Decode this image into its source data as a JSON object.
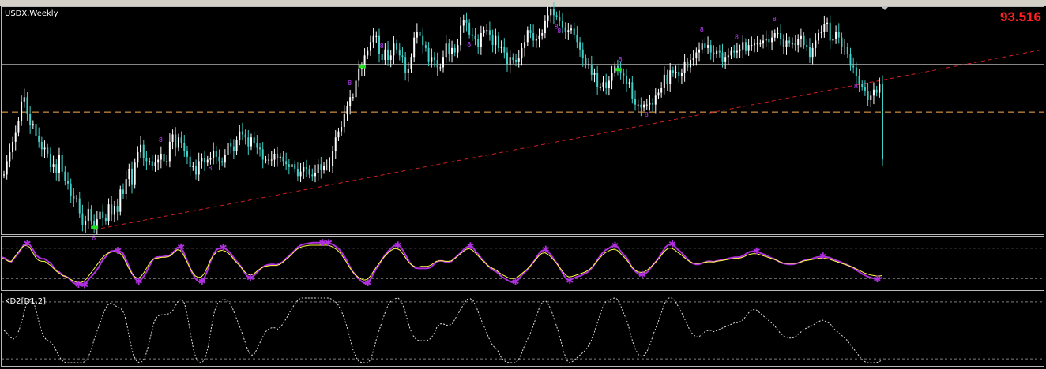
{
  "window": {
    "symbol_label": "USDX,Weekly",
    "current_price": "93.516",
    "price_color": "#ff2020"
  },
  "indicator2": {
    "label": "KD2[D1,2]"
  },
  "colors": {
    "candle_up": "#ffffff",
    "candle_down": "#40d0c8",
    "trendline": "#d02020",
    "support_line": "#ffb050",
    "stoch_main": "#b030e0",
    "stoch_signal": "#ffff40",
    "kd_line": "#e0e0e0",
    "marker": "#c040ff",
    "signal_box": "#20e020"
  },
  "chart_data": [
    {
      "type": "candlestick",
      "pane": "price",
      "title": "USDX,Weekly",
      "last_price": 93.516,
      "ylim": [
        88.5,
        103.8
      ],
      "closes": [
        92.5,
        93.4,
        94.0,
        94.7,
        95.3,
        96.1,
        97.4,
        97.7,
        96.6,
        95.8,
        95.9,
        95.1,
        94.7,
        94.2,
        94.3,
        93.9,
        93.0,
        93.2,
        92.6,
        93.8,
        92.7,
        92.1,
        91.9,
        91.1,
        90.9,
        90.9,
        89.9,
        89.1,
        89.4,
        90.2,
        89.4,
        88.9,
        89.5,
        90.0,
        89.6,
        89.4,
        90.5,
        89.8,
        90.4,
        90.0,
        91.5,
        91.2,
        92.2,
        92.9,
        91.8,
        93.3,
        94.0,
        94.5,
        93.6,
        93.4,
        93.4,
        93.1,
        93.3,
        93.5,
        93.9,
        93.4,
        93.4,
        94.7,
        95.2,
        94.3,
        95.0,
        94.6,
        94.1,
        93.7,
        93.0,
        93.1,
        92.5,
        93.4,
        93.6,
        93.3,
        93.5,
        93.6,
        94.1,
        93.7,
        93.4,
        93.3,
        93.8,
        94.6,
        94.4,
        94.1,
        94.8,
        95.4,
        95.2,
        95.0,
        94.4,
        95.0,
        94.6,
        94.3,
        94.2,
        93.5,
        93.5,
        93.5,
        93.5,
        93.9,
        93.6,
        93.7,
        93.4,
        93.2,
        93.0,
        93.2,
        92.9,
        92.4,
        92.7,
        93.0,
        92.9,
        92.5,
        92.4,
        92.6,
        93.2,
        92.8,
        93.1,
        93.1,
        93.1,
        94.1,
        95.0,
        95.4,
        95.7,
        96.6,
        97.1,
        97.7,
        97.7,
        98.8,
        99.6,
        99.7,
        100.5,
        100.8,
        101.4,
        101.8,
        101.8,
        100.6,
        100.2,
        100.9,
        100.2,
        100.5,
        101.3,
        100.9,
        100.5,
        100.4,
        99.3,
        99.6,
        100.4,
        101.7,
        102.1,
        101.8,
        101.2,
        101.0,
        100.1,
        100.4,
        100.2,
        99.7,
        99.7,
        100.4,
        101.3,
        100.6,
        101.0,
        100.7,
        101.2,
        102.5,
        102.9,
        102.7,
        101.9,
        101.8,
        101.6,
        101.1,
        102.0,
        102.2,
        102.2,
        101.9,
        101.2,
        101.8,
        101.0,
        101.1,
        100.7,
        99.9,
        100.4,
        100.2,
        100.1,
        100.3,
        101.0,
        101.4,
        102.2,
        102.0,
        101.5,
        101.6,
        101.8,
        102.0,
        102.8,
        103.2,
        103.6,
        103.2,
        103.1,
        102.8,
        102.4,
        102.1,
        102.2,
        102.3,
        101.9,
        101.4,
        100.9,
        100.3,
        99.9,
        99.9,
        99.2,
        99.3,
        98.4,
        98.4,
        98.7,
        98.3,
        98.8,
        99.3,
        99.8,
        99.5,
        99.3,
        99.1,
        98.6,
        98.7,
        97.6,
        97.2,
        97.2,
        97.0,
        97.2,
        97.2,
        97.3,
        97.2,
        97.8,
        98.0,
        98.3,
        99.2,
        98.6,
        99.5,
        99.3,
        99.4,
        99.1,
        99.3,
        100.1,
        99.7,
        100.2,
        100.3,
        100.7,
        100.9,
        101.3,
        101.0,
        101.2,
        100.7,
        100.6,
        100.8,
        100.7,
        100.1,
        100.4,
        100.5,
        100.8,
        100.7,
        100.8,
        100.9,
        101.4,
        100.8,
        101.2,
        101.2,
        101.3,
        101.3,
        101.3,
        101.5,
        101.6,
        101.4,
        101.7,
        102.0,
        102.0,
        101.6,
        101.1,
        101.5,
        101.3,
        101.3,
        101.2,
        101.6,
        101.8,
        101.2,
        101.1,
        100.4,
        101.0,
        101.5,
        102.0,
        102.1,
        102.6,
        102.7,
        101.5,
        101.6,
        102.1,
        101.7,
        101.1,
        101.1,
        100.6,
        99.8,
        99.7,
        99.1,
        98.6,
        98.4,
        98.1,
        97.5,
        97.8,
        98.2,
        98.0,
        98.6,
        93.516
      ]
    },
    {
      "type": "line",
      "pane": "stochastic",
      "ylim": [
        0,
        100
      ],
      "levels": [
        20,
        80
      ],
      "series": [
        {
          "values": [
            62,
            60,
            55,
            53,
            61,
            68,
            76,
            86,
            89,
            87,
            79,
            68,
            62,
            59,
            59,
            54,
            51,
            42,
            35,
            32,
            26,
            24,
            21,
            14,
            10,
            8,
            9,
            7,
            13,
            21,
            27,
            34,
            43,
            54,
            61,
            69,
            74,
            75,
            75,
            74,
            70,
            58,
            44,
            30,
            20,
            14,
            17,
            25,
            35,
            47,
            58,
            62,
            63,
            63,
            64,
            64,
            68,
            74,
            81,
            82,
            74,
            60,
            45,
            31,
            20,
            14,
            14,
            21,
            35,
            53,
            67,
            77,
            80,
            81,
            79,
            74,
            68,
            59,
            52,
            45,
            35,
            26,
            21,
            23,
            29,
            35,
            41,
            45,
            47,
            48,
            48,
            47,
            50,
            53,
            59,
            64,
            70,
            76,
            82,
            86,
            88,
            89,
            90,
            91,
            91,
            91,
            91,
            90,
            91,
            89,
            86,
            82,
            76,
            68,
            59,
            47,
            36,
            28,
            21,
            15,
            11,
            11,
            17,
            28,
            39,
            48,
            58,
            67,
            74,
            80,
            85,
            86,
            84,
            75,
            64,
            53,
            46,
            41,
            40,
            40,
            40,
            40,
            42,
            47,
            53,
            55,
            55,
            53,
            53,
            54,
            60,
            65,
            71,
            77,
            82,
            84,
            82,
            74,
            67,
            59,
            53,
            46,
            40,
            36,
            33,
            27,
            22,
            19,
            15,
            13,
            13,
            17,
            24,
            31,
            36,
            43,
            51,
            60,
            69,
            75,
            77,
            73,
            67,
            58,
            50,
            40,
            29,
            20,
            16,
            19,
            22,
            24,
            26,
            29,
            32,
            37,
            44,
            53,
            62,
            70,
            76,
            79,
            83,
            85,
            83,
            75,
            68,
            62,
            52,
            41,
            34,
            29,
            27,
            28,
            33,
            40,
            48,
            55,
            63,
            73,
            82,
            87,
            88,
            84,
            78,
            73,
            67,
            60,
            54,
            50,
            48,
            48,
            50,
            52,
            54,
            54,
            53,
            55,
            56,
            57,
            58,
            60,
            61,
            62,
            62,
            63,
            66,
            70,
            73,
            74,
            74,
            72,
            69,
            67,
            64,
            61,
            59,
            56,
            52,
            50,
            49,
            48,
            48,
            49,
            51,
            53,
            56,
            57,
            58,
            60,
            62,
            63,
            64,
            63,
            62,
            60,
            57,
            55,
            53,
            50,
            48,
            45,
            42,
            38,
            34,
            30,
            27,
            24,
            22,
            20,
            19,
            20,
            22
          ]
        },
        {
          "values": [
            60,
            58,
            54,
            54,
            62,
            70,
            78,
            84,
            86,
            82,
            72,
            62,
            56,
            54,
            54,
            50,
            46,
            40,
            34,
            30,
            26,
            24,
            21,
            17,
            14,
            12,
            12,
            14,
            20,
            28,
            36,
            44,
            52,
            60,
            66,
            70,
            72,
            73,
            72,
            70,
            64,
            52,
            40,
            30,
            23,
            20,
            24,
            32,
            42,
            52,
            58,
            60,
            61,
            62,
            62,
            63,
            66,
            72,
            77,
            76,
            68,
            56,
            44,
            33,
            25,
            22,
            23,
            30,
            42,
            56,
            66,
            72,
            75,
            76,
            74,
            70,
            64,
            56,
            50,
            44,
            36,
            30,
            27,
            28,
            32,
            37,
            41,
            44,
            45,
            46,
            46,
            46,
            48,
            52,
            57,
            62,
            68,
            74,
            79,
            82,
            84,
            85,
            86,
            86,
            86,
            86,
            86,
            86,
            86,
            84,
            81,
            77,
            71,
            63,
            54,
            44,
            35,
            28,
            23,
            19,
            17,
            18,
            24,
            33,
            42,
            50,
            58,
            65,
            71,
            76,
            79,
            79,
            76,
            68,
            59,
            51,
            46,
            43,
            43,
            44,
            44,
            44,
            46,
            50,
            54,
            55,
            55,
            54,
            54,
            55,
            59,
            64,
            69,
            74,
            78,
            79,
            76,
            70,
            64,
            57,
            52,
            46,
            42,
            39,
            36,
            31,
            27,
            24,
            21,
            20,
            20,
            23,
            28,
            33,
            38,
            44,
            51,
            58,
            65,
            70,
            71,
            68,
            63,
            56,
            49,
            41,
            33,
            26,
            23,
            24,
            26,
            28,
            30,
            32,
            35,
            39,
            45,
            52,
            59,
            66,
            71,
            74,
            77,
            78,
            76,
            70,
            64,
            58,
            50,
            42,
            36,
            33,
            32,
            33,
            37,
            42,
            48,
            54,
            61,
            69,
            76,
            80,
            80,
            77,
            72,
            68,
            63,
            58,
            54,
            51,
            50,
            50,
            51,
            52,
            53,
            53,
            53,
            54,
            55,
            56,
            57,
            58,
            59,
            60,
            60,
            61,
            63,
            66,
            68,
            69,
            69,
            68,
            66,
            64,
            62,
            60,
            58,
            56,
            53,
            51,
            50,
            50,
            50,
            50,
            51,
            53,
            55,
            56,
            57,
            58,
            59,
            60,
            60,
            60,
            59,
            57,
            55,
            53,
            51,
            49,
            47,
            45,
            43,
            40,
            37,
            34,
            31,
            29,
            27,
            26,
            25,
            25,
            26
          ]
        }
      ]
    },
    {
      "type": "line",
      "pane": "KD2[D1,2]",
      "title": "KD2[D1,2]",
      "ylim": [
        0,
        100
      ],
      "levels": [
        0,
        100
      ],
      "series": [
        {
          "values": [
            50,
            46,
            40,
            36,
            40,
            50,
            64,
            84,
            96,
            99,
            92,
            75,
            56,
            42,
            36,
            33,
            30,
            22,
            13,
            5,
            1,
            0,
            0,
            0,
            0,
            0,
            0,
            2,
            8,
            20,
            36,
            50,
            62,
            76,
            86,
            92,
            92,
            88,
            86,
            83,
            76,
            56,
            32,
            12,
            3,
            0,
            2,
            10,
            26,
            46,
            64,
            72,
            74,
            74,
            75,
            76,
            80,
            88,
            96,
            98,
            92,
            72,
            46,
            20,
            5,
            0,
            1,
            8,
            28,
            56,
            80,
            92,
            96,
            98,
            97,
            92,
            84,
            72,
            60,
            48,
            34,
            20,
            12,
            12,
            20,
            30,
            40,
            48,
            52,
            54,
            54,
            52,
            56,
            62,
            70,
            78,
            86,
            93,
            98,
            100,
            100,
            100,
            100,
            100,
            100,
            100,
            100,
            100,
            100,
            98,
            95,
            90,
            82,
            70,
            56,
            38,
            20,
            8,
            2,
            0,
            0,
            0,
            6,
            22,
            40,
            54,
            68,
            82,
            92,
            97,
            99,
            100,
            96,
            84,
            68,
            52,
            42,
            36,
            34,
            34,
            34,
            35,
            38,
            46,
            56,
            60,
            60,
            58,
            58,
            60,
            68,
            76,
            84,
            92,
            98,
            99,
            96,
            86,
            74,
            62,
            52,
            40,
            30,
            24,
            20,
            10,
            4,
            1,
            0,
            0,
            0,
            4,
            14,
            26,
            36,
            46,
            58,
            72,
            86,
            94,
            96,
            90,
            80,
            66,
            52,
            36,
            18,
            4,
            0,
            2,
            6,
            10,
            14,
            18,
            24,
            32,
            44,
            58,
            72,
            86,
            94,
            97,
            99,
            100,
            98,
            88,
            76,
            66,
            50,
            32,
            20,
            12,
            10,
            12,
            20,
            32,
            46,
            58,
            70,
            84,
            96,
            100,
            100,
            96,
            88,
            80,
            70,
            60,
            50,
            44,
            40,
            40,
            44,
            48,
            50,
            50,
            48,
            50,
            52,
            54,
            56,
            58,
            60,
            62,
            62,
            64,
            68,
            74,
            80,
            82,
            82,
            78,
            74,
            70,
            66,
            62,
            58,
            52,
            46,
            42,
            40,
            38,
            38,
            40,
            44,
            48,
            52,
            54,
            56,
            58,
            62,
            64,
            66,
            64,
            62,
            58,
            52,
            48,
            44,
            40,
            36,
            30,
            24,
            18,
            12,
            6,
            2,
            0,
            0,
            0,
            0,
            2,
            4
          ]
        }
      ]
    }
  ]
}
